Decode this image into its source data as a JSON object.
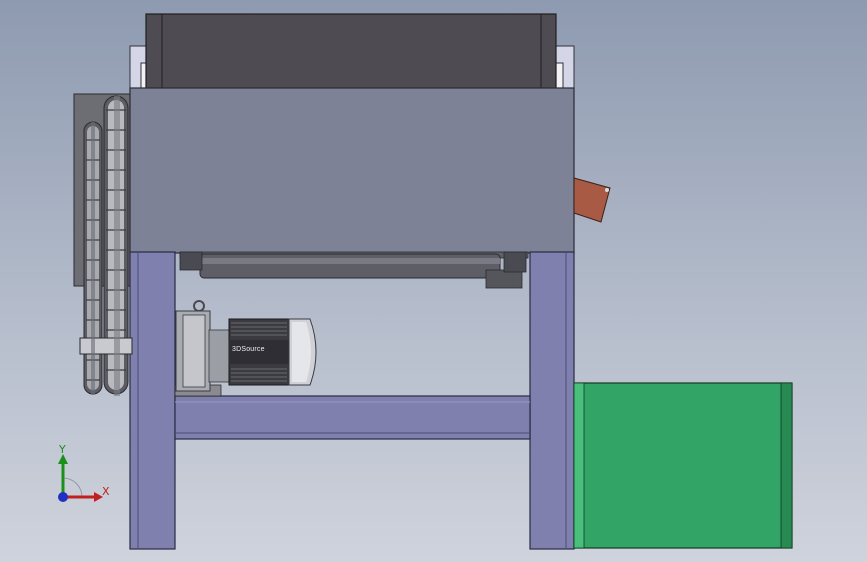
{
  "model": {
    "motor_brand_text": "3DSource"
  },
  "triad": {
    "y_label": "Y",
    "x_label": "X",
    "y_color": "#1a8f1a",
    "x_color": "#c02020",
    "z_color": "#2030c0"
  },
  "colors": {
    "hopper_dark": "#4e4c52",
    "body_gray": "#7d8296",
    "frame_purple": "#7f80ae",
    "box_green": "#32a466",
    "chute_brown": "#a85a45"
  }
}
